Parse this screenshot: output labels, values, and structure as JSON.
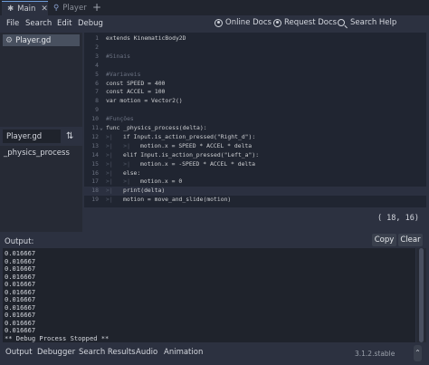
{
  "scene_tabs": {
    "tabs": [
      {
        "label": "Main",
        "active": true
      },
      {
        "label": "Player",
        "active": false
      }
    ],
    "add_glyph": "+"
  },
  "menu": {
    "items": [
      "File",
      "Search",
      "Edit",
      "Debug"
    ],
    "help": [
      "Online Docs",
      "Request Docs",
      "Search Help"
    ]
  },
  "scripts": {
    "items": [
      "Player.gd"
    ]
  },
  "methods": {
    "title": "Player.gd",
    "items": [
      "_physics_process"
    ]
  },
  "editor": {
    "lines": [
      {
        "n": "1",
        "text": "extends KinematicBody2D"
      },
      {
        "n": "2",
        "text": ""
      },
      {
        "n": "3",
        "text": "#Sinais"
      },
      {
        "n": "4",
        "text": ""
      },
      {
        "n": "5",
        "text": "#Variaveis"
      },
      {
        "n": "6",
        "text": "const SPEED = 400"
      },
      {
        "n": "7",
        "text": "const ACCEL = 100"
      },
      {
        "n": "8",
        "text": "var motion = Vector2()"
      },
      {
        "n": "9",
        "text": ""
      },
      {
        "n": "10",
        "text": "#Funções"
      },
      {
        "n": "11",
        "text": "func _physics_process(delta):"
      },
      {
        "n": "12",
        "text": "if Input.is_action_pressed(\"Right_d\"):"
      },
      {
        "n": "13",
        "text": "motion.x = SPEED * ACCEL * delta"
      },
      {
        "n": "14",
        "text": "elif Input.is_action_pressed(\"Left_a\"):"
      },
      {
        "n": "15",
        "text": "motion.x = -SPEED * ACCEL * delta"
      },
      {
        "n": "16",
        "text": "else:"
      },
      {
        "n": "17",
        "text": "motion.x = 0"
      },
      {
        "n": "18",
        "text": "print(delta)"
      },
      {
        "n": "19",
        "text": "motion = move_and_slide(motion)"
      }
    ],
    "current_line": "18",
    "cursor": "( 18, 16)"
  },
  "output": {
    "title": "Output:",
    "copy_label": "Copy",
    "clear_label": "Clear",
    "lines": [
      "0.016667",
      "0.016667",
      "0.016667",
      "0.016667",
      "0.016667",
      "0.016667",
      "0.016667",
      "0.016667",
      "0.016667",
      "0.016667",
      "0.016667",
      "** Debug Process Stopped **"
    ]
  },
  "bottom": {
    "tabs": [
      "Output",
      "Debugger",
      "Search Results",
      "Audio",
      "Animation"
    ],
    "active": "Output",
    "version": "3.1.2.stable",
    "scroll_glyph": "⌃"
  },
  "colors": {
    "accent": "#6d9bd8",
    "keyword": "#ff7085",
    "function": "#57b3ff",
    "string": "#ffeda1",
    "number": "#a1ffe0",
    "comment": "#6c7383",
    "type": "#42ffc2",
    "background": "#2c3140",
    "editor_background": "#202531"
  },
  "icons": {
    "main_tab": "scene-icon",
    "player_tab": "node-icon",
    "script_item": "script-gear-icon",
    "methods_sort": "sort-icon",
    "online_docs": "help-icon",
    "request_docs": "help-icon",
    "search_help": "search-icon"
  }
}
